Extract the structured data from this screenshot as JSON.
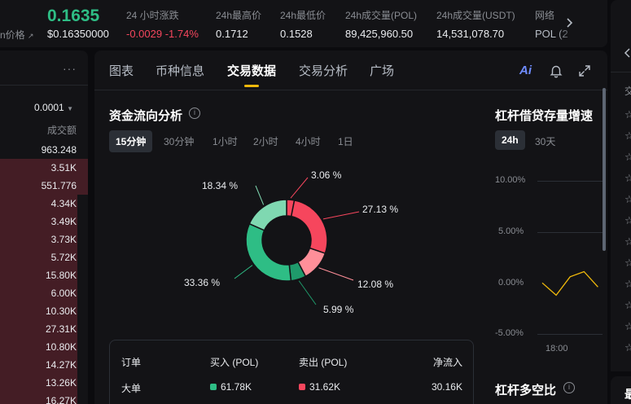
{
  "ticker": {
    "last_price": "0.1635",
    "prev_label": "n价格",
    "usd_price": "$0.16350000",
    "stats": [
      {
        "label": "24 小时涨跌",
        "value": "-0.0029 -1.74%"
      },
      {
        "label": "24h最高价",
        "value": "0.1712"
      },
      {
        "label": "24h最低价",
        "value": "0.1528"
      },
      {
        "label": "24h成交量(POL)",
        "value": "89,425,960.50"
      },
      {
        "label": "24h成交量(USDT)",
        "value": "14,531,078.70"
      },
      {
        "label": "网络",
        "value": "POL (2"
      }
    ]
  },
  "orderbook": {
    "more": "···",
    "precision": "0.0001",
    "column_header": "成交额",
    "rows": [
      {
        "value": "963.248",
        "depth": 0.0
      },
      {
        "value": "3.51K",
        "depth": 1.0
      },
      {
        "value": "551.776",
        "depth": 1.0
      },
      {
        "value": "4.34K",
        "depth": 0.88
      },
      {
        "value": "3.49K",
        "depth": 0.88
      },
      {
        "value": "3.73K",
        "depth": 0.88
      },
      {
        "value": "5.72K",
        "depth": 0.88
      },
      {
        "value": "15.80K",
        "depth": 0.88
      },
      {
        "value": "6.00K",
        "depth": 0.88
      },
      {
        "value": "10.30K",
        "depth": 0.88
      },
      {
        "value": "27.31K",
        "depth": 0.88
      },
      {
        "value": "10.80K",
        "depth": 0.88
      },
      {
        "value": "14.27K",
        "depth": 0.88
      },
      {
        "value": "13.26K",
        "depth": 0.88
      },
      {
        "value": "16.27K",
        "depth": 0.88
      }
    ]
  },
  "tabs": [
    "图表",
    "币种信息",
    "交易数据",
    "交易分析",
    "广场"
  ],
  "active_tab": "交易数据",
  "ai_label": "Ai",
  "fund_flow": {
    "title": "资金流向分析",
    "intervals": [
      "15分钟",
      "30分钟",
      "1小时",
      "2小时",
      "4小时",
      "1日"
    ],
    "active_interval": "15分钟",
    "donut": [
      {
        "label": "3.06 %",
        "percent": 3.06,
        "color": "#f6465d"
      },
      {
        "label": "27.13 %",
        "percent": 27.13,
        "color": "#f6465d"
      },
      {
        "label": "12.08 %",
        "percent": 12.08,
        "color": "#ff8f99"
      },
      {
        "label": "5.99 %",
        "percent": 5.99,
        "color": "#1f9a6b"
      },
      {
        "label": "33.36 %",
        "percent": 33.36,
        "color": "#2ebd85"
      },
      {
        "label": "18.34 %",
        "percent": 18.34,
        "color": "#7fd8b1"
      }
    ],
    "summary": {
      "headers": {
        "order": "订单",
        "buy": "买入 (POL)",
        "sell": "卖出 (POL)",
        "net": "净流入"
      },
      "row": {
        "order": "大单",
        "buy": "61.78K",
        "sell": "31.62K",
        "net": "30.16K"
      }
    },
    "colors": {
      "buy": "#2ebd85",
      "sell": "#f6465d"
    }
  },
  "margin": {
    "title": "杠杆借贷存量增速",
    "intervals": [
      "24h",
      "30天"
    ],
    "active_interval": "24h",
    "y_ticks": [
      "10.00%",
      "5.00%",
      "0.00%",
      "-5.00%"
    ],
    "x_tick": "18:00",
    "ratio_title": "杠杆多空比"
  },
  "margin_chart": {
    "type": "line",
    "x": [
      0,
      1,
      2,
      3,
      4
    ],
    "y": [
      0.0,
      -1.2,
      0.6,
      1.1,
      -0.4
    ],
    "ylim": [
      -5,
      10
    ],
    "color": "#f0b90b"
  },
  "right_panel": {
    "label": "交",
    "bottom_label": "最"
  }
}
